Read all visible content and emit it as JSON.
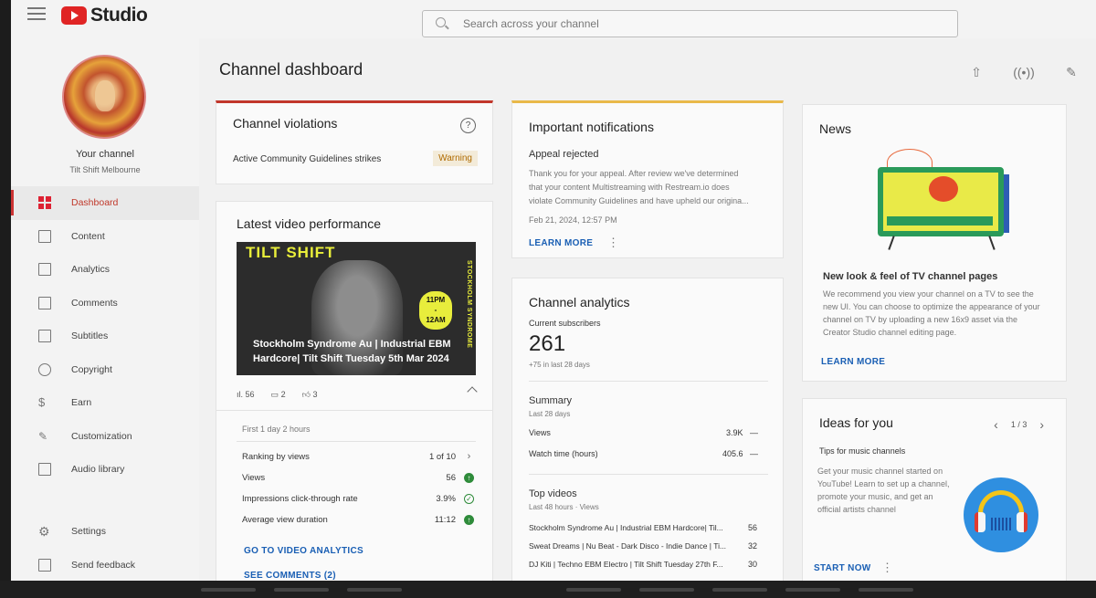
{
  "app": {
    "logo_text": "Studio"
  },
  "search": {
    "placeholder": "Search across your channel"
  },
  "sidebar": {
    "your_channel": "Your channel",
    "channel_name": "Tilt Shift Melbourne",
    "items": [
      {
        "label": "Dashboard",
        "icon": "dashboard-icon",
        "active": true
      },
      {
        "label": "Content",
        "icon": "content-icon"
      },
      {
        "label": "Analytics",
        "icon": "analytics-icon"
      },
      {
        "label": "Comments",
        "icon": "comments-icon"
      },
      {
        "label": "Subtitles",
        "icon": "subtitles-icon"
      },
      {
        "label": "Copyright",
        "icon": "copyright-icon"
      },
      {
        "label": "Earn",
        "icon": "earn-icon"
      },
      {
        "label": "Customization",
        "icon": "customization-icon"
      },
      {
        "label": "Audio library",
        "icon": "audio-library-icon"
      }
    ],
    "bottom": [
      {
        "label": "Settings",
        "icon": "gear-icon"
      },
      {
        "label": "Send feedback",
        "icon": "feedback-icon"
      }
    ]
  },
  "page": {
    "title": "Channel dashboard"
  },
  "violations": {
    "title": "Channel violations",
    "row_label": "Active Community Guidelines strikes",
    "badge": "Warning"
  },
  "latest": {
    "title": "Latest video performance",
    "thumb_brand": "TILT SHIFT",
    "thumb_side": "STOCKHOLM SYNDROME",
    "thumb_time_1": "11PM",
    "thumb_time_2": "-",
    "thumb_time_3": "12AM",
    "thumb_caption": "Stockholm Syndrome Au | Industrial EBM Hardcore| Tilt Shift Tuesday 5th Mar 2024",
    "views_count": "56",
    "comments_count": "2",
    "likes_count": "3",
    "period": "First 1 day 2 hours",
    "metrics": [
      {
        "label": "Ranking by views",
        "value": "1 of 10"
      },
      {
        "label": "Views",
        "value": "56"
      },
      {
        "label": "Impressions click-through rate",
        "value": "3.9%"
      },
      {
        "label": "Average view duration",
        "value": "11:12"
      }
    ],
    "link_analytics": "GO TO VIDEO ANALYTICS",
    "link_comments": "SEE COMMENTS (2)"
  },
  "notifications": {
    "title": "Important notifications",
    "subtitle": "Appeal rejected",
    "body_1": "Thank you for your appeal. After review we've determined",
    "body_2": "that your content Multistreaming with Restream.io does",
    "body_3": "violate Community Guidelines and have upheld our origina...",
    "date": "Feb 21, 2024, 12:57 PM",
    "link": "LEARN MORE"
  },
  "analytics": {
    "title": "Channel analytics",
    "subs_label": "Current subscribers",
    "subs_value": "261",
    "subs_change": "+75 in last 28 days",
    "summary_title": "Summary",
    "summary_period": "Last 28 days",
    "summary_rows": [
      {
        "label": "Views",
        "value": "3.9K",
        "trend": "—"
      },
      {
        "label": "Watch time (hours)",
        "value": "405.6",
        "trend": "—"
      }
    ],
    "top_title": "Top videos",
    "top_period": "Last 48 hours · Views",
    "top_videos": [
      {
        "title": "Stockholm Syndrome Au | Industrial EBM Hardcore| Til...",
        "views": "56"
      },
      {
        "title": "Sweat Dreams | Nu Beat - Dark Disco - Indie Dance | Ti...",
        "views": "32"
      },
      {
        "title": "DJ Kiti | Techno EBM Electro | Tilt Shift Tuesday 27th F...",
        "views": "30"
      }
    ]
  },
  "news": {
    "title": "News",
    "headline": "New look & feel of TV channel pages",
    "body_1": "We recommend you view your channel on a TV to see the",
    "body_2": "new UI. You can choose to optimize the appearance of your",
    "body_3": "channel on TV by uploading a new 16x9 asset via the",
    "body_4": "Creator Studio channel editing page.",
    "link": "LEARN MORE"
  },
  "ideas": {
    "title": "Ideas for you",
    "pager": "1 / 3",
    "subtitle": "Tips for music channels",
    "body_1": "Get your music channel started on",
    "body_2": "YouTube! Learn to set up a channel,",
    "body_3": "promote your music, and get an",
    "body_4": "official artists channel",
    "link": "START NOW"
  },
  "colors": {
    "accent_red": "#c0392b",
    "link_blue": "#1a5fb4",
    "warning_bg": "#f3ebd9",
    "success_green": "#2e8b3a"
  }
}
